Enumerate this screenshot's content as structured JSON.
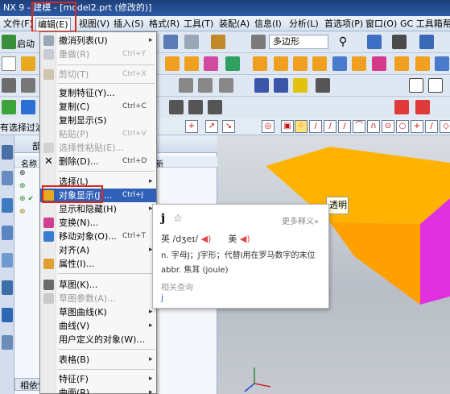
{
  "window": {
    "title": "NX 9 - 建模 - [model2.prt (修改的)]"
  },
  "menubar": {
    "items": [
      "文件(F)",
      "编辑(E)",
      "视图(V)",
      "插入(S)",
      "格式(R)",
      "工具(T)",
      "装配(A)",
      "信息(I)",
      "分析(L)",
      "首选项(P)",
      "窗口(O)",
      "GC 工具箱",
      "帮"
    ]
  },
  "toolbar": {
    "start_label": "启动",
    "shape_combo_value": "多边形"
  },
  "selection_bar": {
    "filter_text": "有选择过滤"
  },
  "navigator": {
    "title": "部",
    "col_name": "名称",
    "col_new": "新",
    "bottom_tab": "相依性"
  },
  "edit_menu": {
    "items": [
      {
        "label": "撤消列表(U)",
        "shortcut": "",
        "submenu": true,
        "disabled": false,
        "icon": "undo-list-icon"
      },
      {
        "label": "重做(R)",
        "shortcut": "Ctrl+Y",
        "submenu": false,
        "disabled": true,
        "icon": "redo-icon"
      },
      {
        "label": "剪切(T)",
        "shortcut": "Ctrl+X",
        "submenu": false,
        "disabled": true,
        "icon": "cut-icon"
      },
      {
        "label": "复制特征(Y)...",
        "shortcut": "",
        "submenu": false,
        "disabled": false,
        "icon": ""
      },
      {
        "label": "复制(C)",
        "shortcut": "Ctrl+C",
        "submenu": false,
        "disabled": false,
        "icon": ""
      },
      {
        "label": "复制显示(S)",
        "shortcut": "",
        "submenu": false,
        "disabled": false,
        "icon": ""
      },
      {
        "label": "粘贴(P)",
        "shortcut": "Ctrl+V",
        "submenu": false,
        "disabled": true,
        "icon": ""
      },
      {
        "label": "选择性粘贴(E)...",
        "shortcut": "",
        "submenu": false,
        "disabled": true,
        "icon": "paste-special-icon"
      },
      {
        "label": "删除(D)...",
        "shortcut": "Ctrl+D",
        "submenu": false,
        "disabled": false,
        "icon": "delete-x-icon"
      },
      {
        "label": "选择(L)",
        "shortcut": "",
        "submenu": true,
        "disabled": false,
        "icon": ""
      },
      {
        "label": "对象显示(J)...",
        "shortcut": "Ctrl+J",
        "submenu": false,
        "disabled": false,
        "icon": "object-display-icon"
      },
      {
        "label": "显示和隐藏(H)",
        "shortcut": "",
        "submenu": true,
        "disabled": false,
        "icon": ""
      },
      {
        "label": "变换(N)...",
        "shortcut": "",
        "submenu": false,
        "disabled": false,
        "icon": "transform-icon"
      },
      {
        "label": "移动对象(O)...",
        "shortcut": "Ctrl+T",
        "submenu": false,
        "disabled": false,
        "icon": "move-object-icon"
      },
      {
        "label": "对齐(A)",
        "shortcut": "",
        "submenu": true,
        "disabled": false,
        "icon": ""
      },
      {
        "label": "属性(I)...",
        "shortcut": "",
        "submenu": false,
        "disabled": false,
        "icon": "properties-icon"
      },
      {
        "label": "草图(K)...",
        "shortcut": "",
        "submenu": false,
        "disabled": false,
        "icon": "sketch-icon"
      },
      {
        "label": "草图参数(A)...",
        "shortcut": "",
        "submenu": false,
        "disabled": true,
        "icon": "sketch-params-icon"
      },
      {
        "label": "草图曲线(K)",
        "shortcut": "",
        "submenu": true,
        "disabled": false,
        "icon": ""
      },
      {
        "label": "曲线(V)",
        "shortcut": "",
        "submenu": true,
        "disabled": false,
        "icon": ""
      },
      {
        "label": "用户定义的对象(W)...",
        "shortcut": "",
        "submenu": false,
        "disabled": false,
        "icon": ""
      },
      {
        "label": "表格(B)",
        "shortcut": "",
        "submenu": true,
        "disabled": false,
        "icon": ""
      },
      {
        "label": "特征(F)",
        "shortcut": "",
        "submenu": true,
        "disabled": false,
        "icon": ""
      },
      {
        "label": "曲面(R)",
        "shortcut": "",
        "submenu": true,
        "disabled": false,
        "icon": ""
      }
    ]
  },
  "dictionary": {
    "word": "j",
    "star": "☆",
    "more": "更多释义»",
    "pron_uk": "英 /dʒeɪ/",
    "pron_us": "美",
    "def1": "n. 字母J；J字形；代替I用在罗马数字的末位",
    "def2": "abbr. 焦耳 (joule)",
    "related_title": "相关查询",
    "related_item": "j"
  },
  "tooltip": {
    "text": "透明"
  },
  "colors": {
    "accent_red": "#e0251b",
    "menu_highlight": "#3160b8",
    "model_orange": "#ffb300",
    "model_magenta": "#e030e0"
  }
}
